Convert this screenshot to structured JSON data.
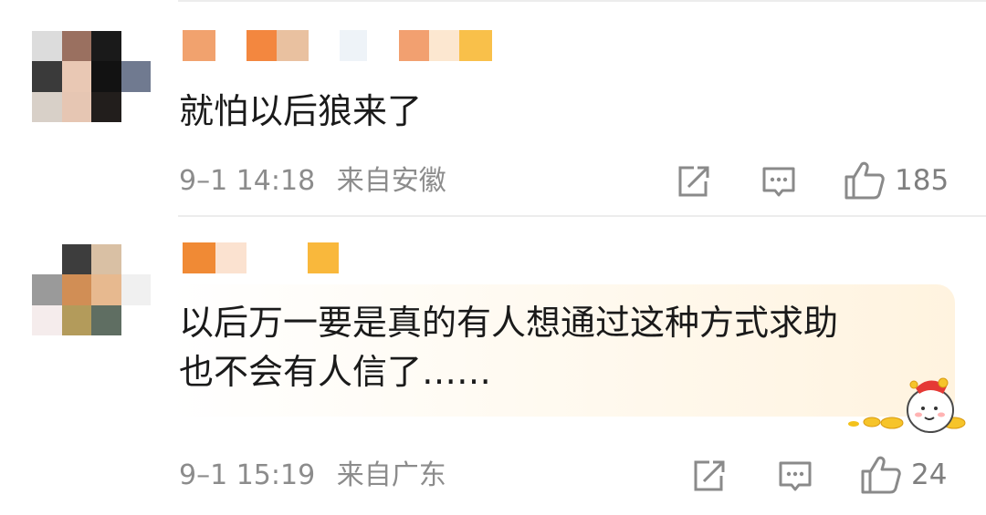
{
  "comments": [
    {
      "text_lines": [
        "就怕以后狼来了"
      ],
      "time": "9–1 14:18",
      "location": "来自安徽",
      "like_count": "185",
      "avatar_colors": [
        "#dcdcdc",
        "#9a7060",
        "#1a1a1a",
        "#ffffff",
        "#3a3a3a",
        "#e9c8b4",
        "#121212",
        "#707a90",
        "#d8d0c8",
        "#e6c6b3",
        "#221e1c",
        "#ffffff"
      ],
      "name_colors": [
        "#f1a26e",
        "#f3873f",
        "#e9c1a0",
        "#eef3f8",
        "#f2a070",
        "#fce7d0",
        "#f9c04a"
      ]
    },
    {
      "text_lines": [
        "以后万一要是真的有人想通过这种方式求助",
        "也不会有人信了……"
      ],
      "time": "9–1 15:19",
      "location": "来自广东",
      "like_count": "24",
      "avatar_colors": [
        "#ffffff",
        "#3d3d3d",
        "#d9c0a4",
        "#ffffff",
        "#9a9a9a",
        "#d18e55",
        "#e7b98f",
        "#f0f0f0",
        "#f5ecec",
        "#b39b5b",
        "#5f6e62",
        "#ffffff"
      ],
      "name_colors": [
        "#f08a35",
        "#fbe2d0",
        "#f9b83c"
      ]
    }
  ],
  "icons": {
    "share": "share-icon",
    "comment": "comment-icon",
    "like": "thumbs-up-icon",
    "sticker": "gold-coin-mascot-sticker"
  }
}
